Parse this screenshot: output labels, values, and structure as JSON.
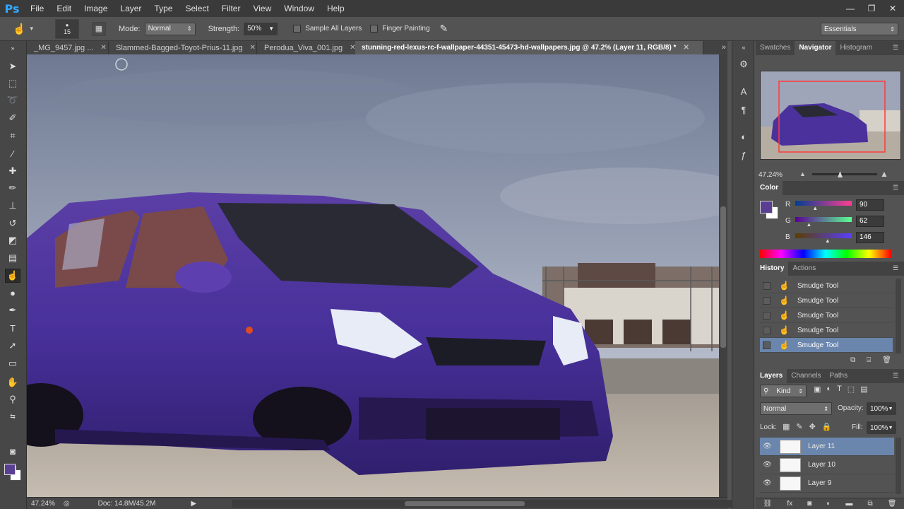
{
  "app": {
    "logo": "Ps"
  },
  "menu": [
    "File",
    "Edit",
    "Image",
    "Layer",
    "Type",
    "Select",
    "Filter",
    "View",
    "Window",
    "Help"
  ],
  "window_controls": [
    "—",
    "❐",
    "✕"
  ],
  "options": {
    "brush_size": "15",
    "mode_label": "Mode:",
    "mode_value": "Normal",
    "strength_label": "Strength:",
    "strength_value": "50%",
    "sample_all_layers": "Sample All Layers",
    "finger_painting": "Finger Painting",
    "workspace": "Essentials"
  },
  "tabs": [
    {
      "label": "_MG_9457.jpg ...",
      "active": false
    },
    {
      "label": "Slammed-Bagged-Toyot-Prius-11.jpg",
      "active": false
    },
    {
      "label": "Perodua_Viva_001.jpg",
      "active": false
    },
    {
      "label": "stunning-red-lexus-rc-f-wallpaper-44351-45473-hd-wallpapers.jpg @ 47.2% (Layer 11, RGB/8) *",
      "active": true
    }
  ],
  "status": {
    "zoom": "47.24%",
    "doc": "Doc: 14.8M/45.2M"
  },
  "navigator": {
    "tabs": [
      "Swatches",
      "Navigator",
      "Histogram"
    ],
    "active_tab": "Navigator",
    "zoom": "47.24%"
  },
  "color_panel": {
    "title": "Color",
    "r_label": "R",
    "g_label": "G",
    "b_label": "B",
    "r": "90",
    "g": "62",
    "b": "146",
    "r_fraction": 0.353,
    "g_fraction": 0.243,
    "b_fraction": 0.573,
    "foreground": "#5a3e92"
  },
  "history": {
    "tabs": [
      "History",
      "Actions"
    ],
    "items": [
      "Smudge Tool",
      "Smudge Tool",
      "Smudge Tool",
      "Smudge Tool",
      "Smudge Tool"
    ],
    "selected_index": 4
  },
  "layers_panel": {
    "tabs": [
      "Layers",
      "Channels",
      "Paths"
    ],
    "filter": "Kind",
    "blend_mode": "Normal",
    "opacity_label": "Opacity:",
    "opacity": "100%",
    "lock_label": "Lock:",
    "fill_label": "Fill:",
    "fill": "100%",
    "layers": [
      {
        "name": "Layer 11",
        "selected": true
      },
      {
        "name": "Layer 10",
        "selected": false
      },
      {
        "name": "Layer 9",
        "selected": false
      }
    ]
  }
}
